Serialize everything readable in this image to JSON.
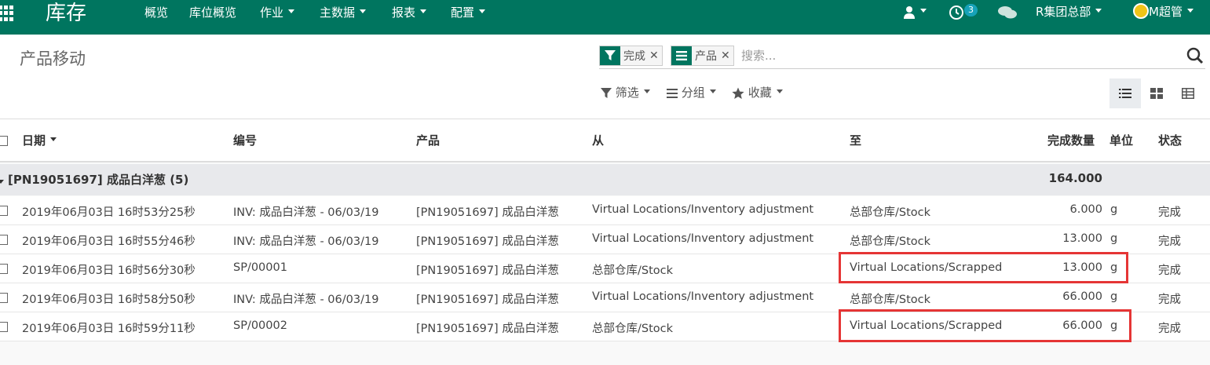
{
  "navbar": {
    "brand": "库存",
    "menus": [
      {
        "label": "概览",
        "dropdown": false
      },
      {
        "label": "库位概览",
        "dropdown": false
      },
      {
        "label": "作业",
        "dropdown": true
      },
      {
        "label": "主数据",
        "dropdown": true
      },
      {
        "label": "报表",
        "dropdown": true
      },
      {
        "label": "配置",
        "dropdown": true
      }
    ],
    "activity_count": "3",
    "company": "R集团总部",
    "user": "M超管",
    "color": "#00755f"
  },
  "control": {
    "title": "产品移动",
    "facets": [
      {
        "icon": "filter-icon",
        "label": "完成"
      },
      {
        "icon": "group-by-icon",
        "label": "产品"
      }
    ],
    "search_placeholder": "搜索...",
    "filter_label": "筛选",
    "group_label": "分组",
    "favorite_label": "收藏",
    "views": [
      "list-view-icon",
      "kanban-view-icon",
      "pivot-view-icon"
    ]
  },
  "list": {
    "columns": {
      "date": "日期",
      "reference": "编号",
      "product": "产品",
      "from": "从",
      "to": "至",
      "qty": "完成数量",
      "uom": "单位",
      "state": "状态"
    },
    "group": {
      "label": "[PN19051697] 成品白洋葱 (5)",
      "total": "164.000"
    },
    "rows": [
      {
        "date": "2019年06月03日 16时53分25秒",
        "reference": "INV: 成品白洋葱 - 06/03/19",
        "product": "[PN19051697] 成品白洋葱",
        "from": "Virtual Locations/Inventory adjustment",
        "to": "总部仓库/Stock",
        "qty": "6.000",
        "uom": "g",
        "state": "完成",
        "highlighted": false
      },
      {
        "date": "2019年06月03日 16时55分46秒",
        "reference": "INV: 成品白洋葱 - 06/03/19",
        "product": "[PN19051697] 成品白洋葱",
        "from": "Virtual Locations/Inventory adjustment",
        "to": "总部仓库/Stock",
        "qty": "13.000",
        "uom": "g",
        "state": "完成",
        "highlighted": false
      },
      {
        "date": "2019年06月03日 16时56分30秒",
        "reference": "SP/00001",
        "product": "[PN19051697] 成品白洋葱",
        "from": "总部仓库/Stock",
        "to": "Virtual Locations/Scrapped",
        "qty": "13.000",
        "uom": "g",
        "state": "完成",
        "highlighted": true
      },
      {
        "date": "2019年06月03日 16时58分50秒",
        "reference": "INV: 成品白洋葱 - 06/03/19",
        "product": "[PN19051697] 成品白洋葱",
        "from": "Virtual Locations/Inventory adjustment",
        "to": "总部仓库/Stock",
        "qty": "66.000",
        "uom": "g",
        "state": "完成",
        "highlighted": false
      },
      {
        "date": "2019年06月03日 16时59分11秒",
        "reference": "SP/00002",
        "product": "[PN19051697] 成品白洋葱",
        "from": "总部仓库/Stock",
        "to": "Virtual Locations/Scrapped",
        "qty": "66.000",
        "uom": "g",
        "state": "完成",
        "highlighted": true
      }
    ],
    "highlight_color": "#e53535"
  }
}
